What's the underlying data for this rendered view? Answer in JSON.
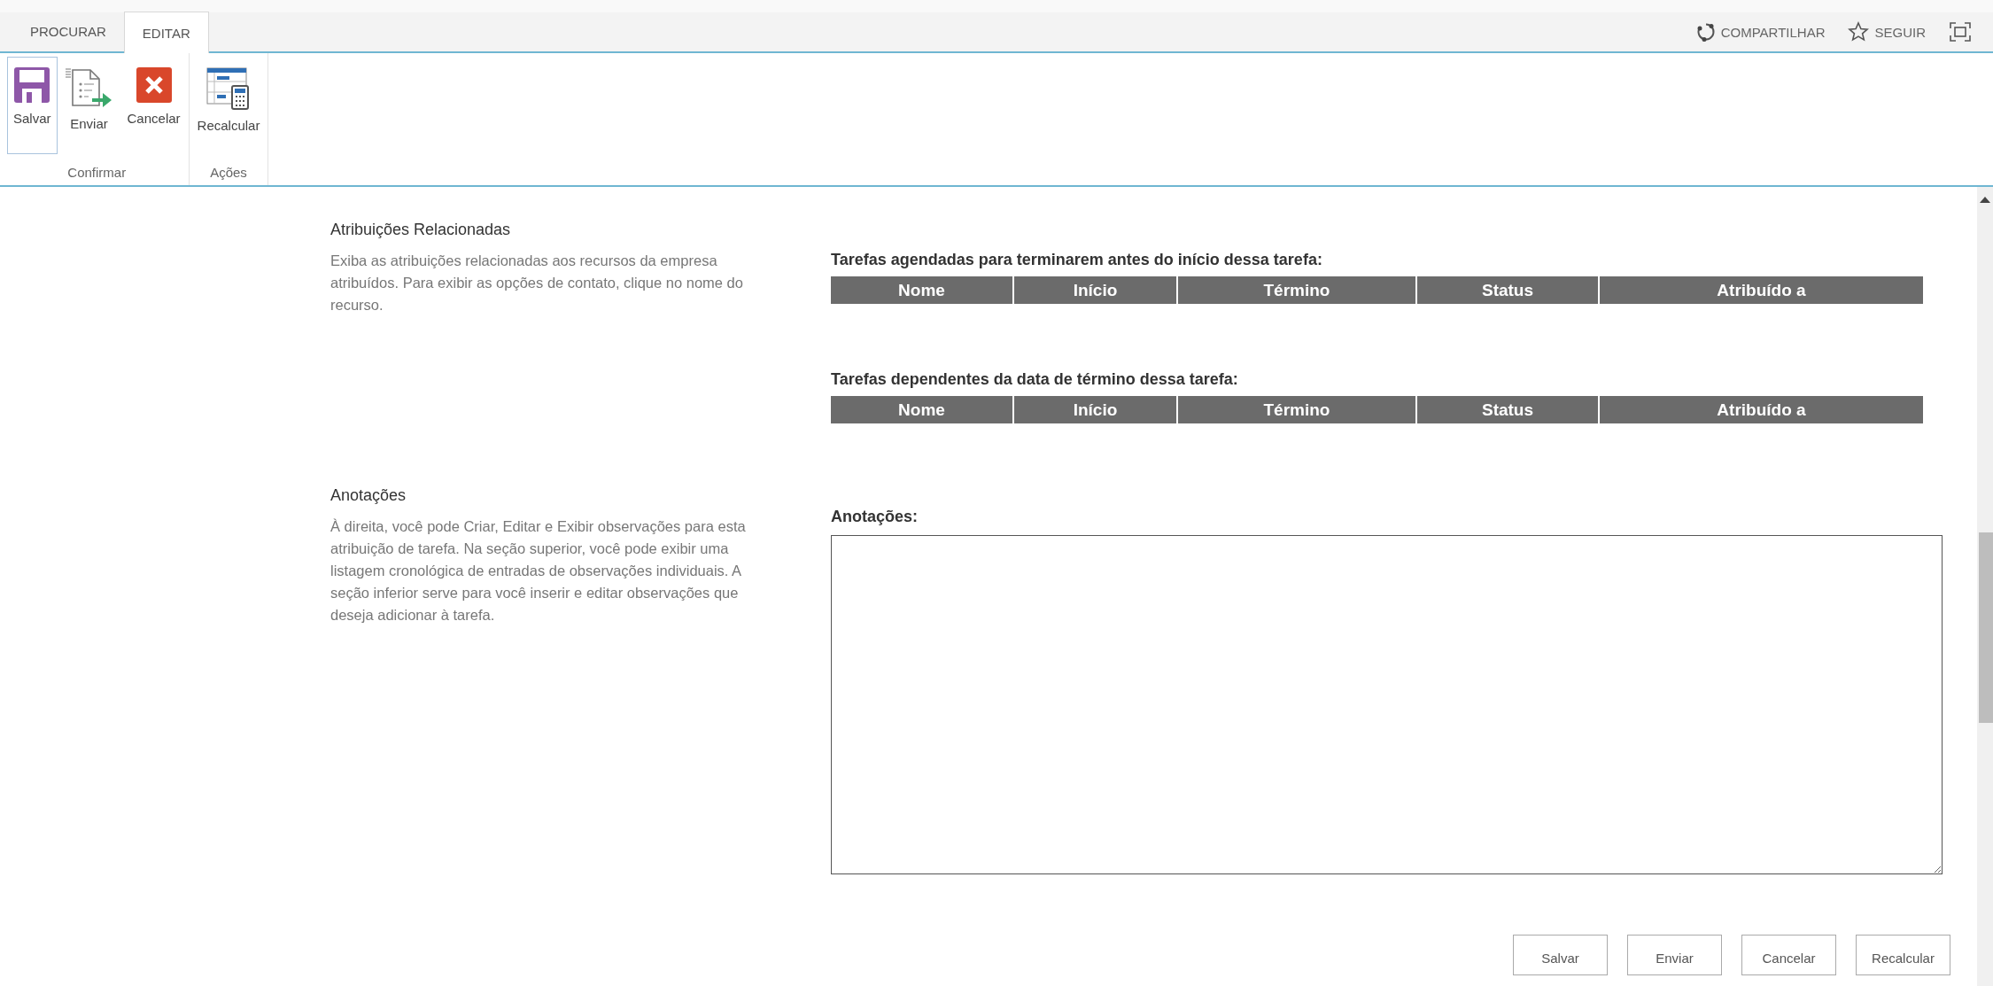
{
  "tabs": [
    {
      "label": "PROCURAR",
      "selected": false
    },
    {
      "label": "EDITAR",
      "selected": true
    }
  ],
  "top_actions": [
    {
      "kind": "share",
      "label": "COMPARTILHAR"
    },
    {
      "kind": "follow",
      "label": "SEGUIR"
    }
  ],
  "ribbon_groups": [
    {
      "label": "Confirmar",
      "buttons": [
        {
          "kind": "save",
          "label": "Salvar",
          "selected": true
        },
        {
          "kind": "send",
          "label": "Enviar",
          "selected": false
        },
        {
          "kind": "cancel",
          "label": "Cancelar",
          "selected": false
        }
      ]
    },
    {
      "label": "Ações",
      "buttons": [
        {
          "kind": "recalc",
          "label": "Recalcular",
          "selected": false
        }
      ]
    }
  ],
  "sections": [
    {
      "title": "Atribuições Relacionadas",
      "description": "Exiba as atribuições relacionadas aos recursos da empresa atribuídos. Para exibir as opções de contato, clique no nome do recurso.",
      "kind": "tables",
      "tables": [
        {
          "title": "Tarefas agendadas para terminarem antes do início dessa tarefa:",
          "columns": [
            "Nome",
            "Início",
            "Término",
            "Status",
            "Atribuído a"
          ]
        },
        {
          "title": "Tarefas dependentes da data de término dessa tarefa:",
          "columns": [
            "Nome",
            "Início",
            "Término",
            "Status",
            "Atribuído a"
          ]
        }
      ]
    },
    {
      "title": "Anotações",
      "description": "À direita, você pode Criar, Editar e Exibir observações para esta atribuição de tarefa. Na seção superior, você pode exibir uma listagem cronológica de entradas de observações individuais. A seção inferior serve para você inserir e editar observações que deseja adicionar à tarefa.",
      "kind": "notes",
      "label": "Anotações:"
    }
  ],
  "footer_buttons": [
    "Salvar",
    "Enviar",
    "Cancelar",
    "Recalcular"
  ]
}
